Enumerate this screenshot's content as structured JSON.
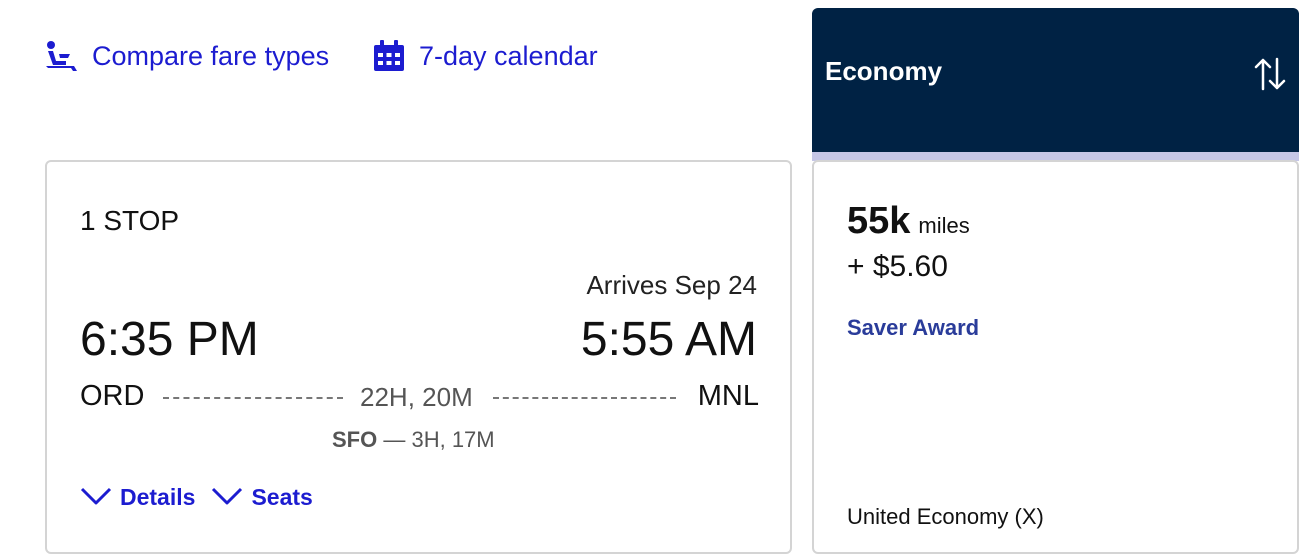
{
  "top_links": {
    "compare_label": "Compare fare types",
    "calendar_label": "7-day calendar"
  },
  "fare_header": {
    "title": "Economy"
  },
  "flight": {
    "stops": "1 STOP",
    "arrives": "Arrives Sep 24",
    "departure_time": "6:35 PM",
    "arrival_time": "5:55 AM",
    "origin": "ORD",
    "destination": "MNL",
    "duration": "22H, 20M",
    "layover_airport": "SFO",
    "layover_separator": " — ",
    "layover_duration": "3H, 17M",
    "details_label": "Details",
    "seats_label": "Seats"
  },
  "fare": {
    "miles": "55k",
    "miles_unit": "miles",
    "tax": "+ $5.60",
    "award_type": "Saver Award",
    "cabin": "United Economy (X)"
  },
  "colors": {
    "link": "#1c1cd0",
    "header_bg": "#002244",
    "header_strip": "#c5c6e6",
    "award": "#2a3c9a"
  },
  "icons": {
    "compare": "seat-icon",
    "calendar": "calendar-icon",
    "sort": "sort-arrows-icon",
    "expand": "chevron-down-icon"
  }
}
